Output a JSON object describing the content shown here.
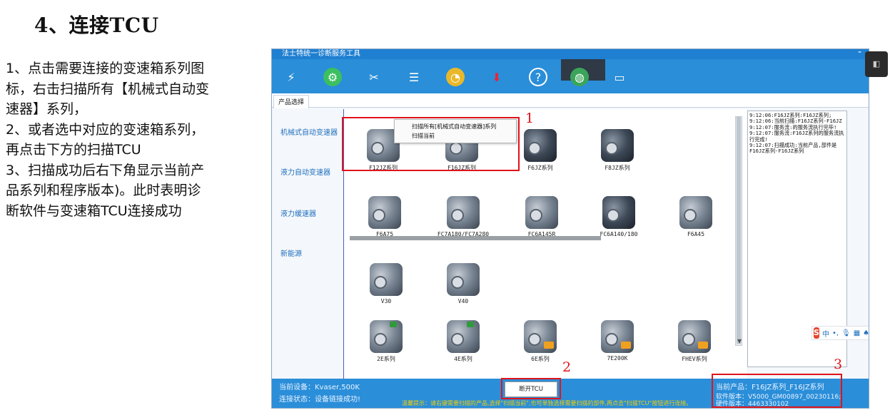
{
  "doc": {
    "heading": "4、连接TCU",
    "steps": [
      "1、点击需要连接的变速箱系列图",
      "标，右击扫描所有【机械式自动变",
      "速器】系列，",
      "2、或者选中对应的变速箱系列，",
      "再点击下方的扫描TCU",
      "3、扫描成功后右下角显示当前产",
      "品系列和程序版本)。此时表明诊",
      "断软件与变速箱TCU连接成功"
    ]
  },
  "app": {
    "title": "法士特统一诊断服务工具",
    "minimize": "-",
    "dropdown_icon": "chevron-down-icon",
    "toolbar_icons": [
      "plug-icon",
      "gear-icon",
      "tools-icon",
      "list-icon",
      "chart-icon",
      "download-icon",
      "help-icon",
      "globe-icon",
      "monitor-icon"
    ],
    "tab": "产品选择",
    "categories": [
      "机械式自动变速器",
      "液力自动变速器",
      "液力缓速器",
      "新能源"
    ],
    "context_menu": [
      "扫描所有[机械式自动变速器]系列",
      "扫描当前"
    ],
    "products": {
      "mechanical": [
        "F12JZ系列",
        "F16JZ系列",
        "F6JZ系列",
        "F8JZ系列"
      ],
      "hydraulic": [
        "F6A75",
        "FC7A180/FC7A280",
        "FC6A145R",
        "FC6A140/180",
        "F6A45"
      ],
      "new_energy_row1": [
        "V30",
        "V40"
      ],
      "new_energy_row2": [
        "2E系列",
        "4E系列",
        "6E系列",
        "7E200K",
        "FHEV系列"
      ]
    },
    "log_lines": [
      "9:12:06:F16JZ系列:F16JZ系列;",
      "9:12:06:当前扫描:F16JZ系列-F16JZ",
      "9:12:07:服务流:的服务流执行完毕!",
      "9:12:07:服务流:F16JZ系列的服务流执行完成!",
      "9:12:07:扫描成功:当前产品,部件是F16JZ系列-F16JZ系列"
    ],
    "ime": "中",
    "status": {
      "device": "当前设备：Kvaser,500K",
      "connection": "连接状态：设备链接成功!",
      "disconnect_button": "断开TCU",
      "hint": "温馨提示：请右键需要扫描的产品,选择\"扫描当前\",也可单独选择需要扫描的部件,再点击\"扫描TCU\"按钮进行连接。",
      "product": "当前产品：F16JZ系列_F16JZ系列",
      "software": "软件版本：V5000_GM00897_00230116;",
      "hardware": "硬件版本：4463330102"
    }
  },
  "annotations": {
    "callout_1": "1",
    "callout_2": "2",
    "callout_3": "3",
    "accent_red": "#e0141a",
    "app_blue": "#2a8ed9"
  }
}
